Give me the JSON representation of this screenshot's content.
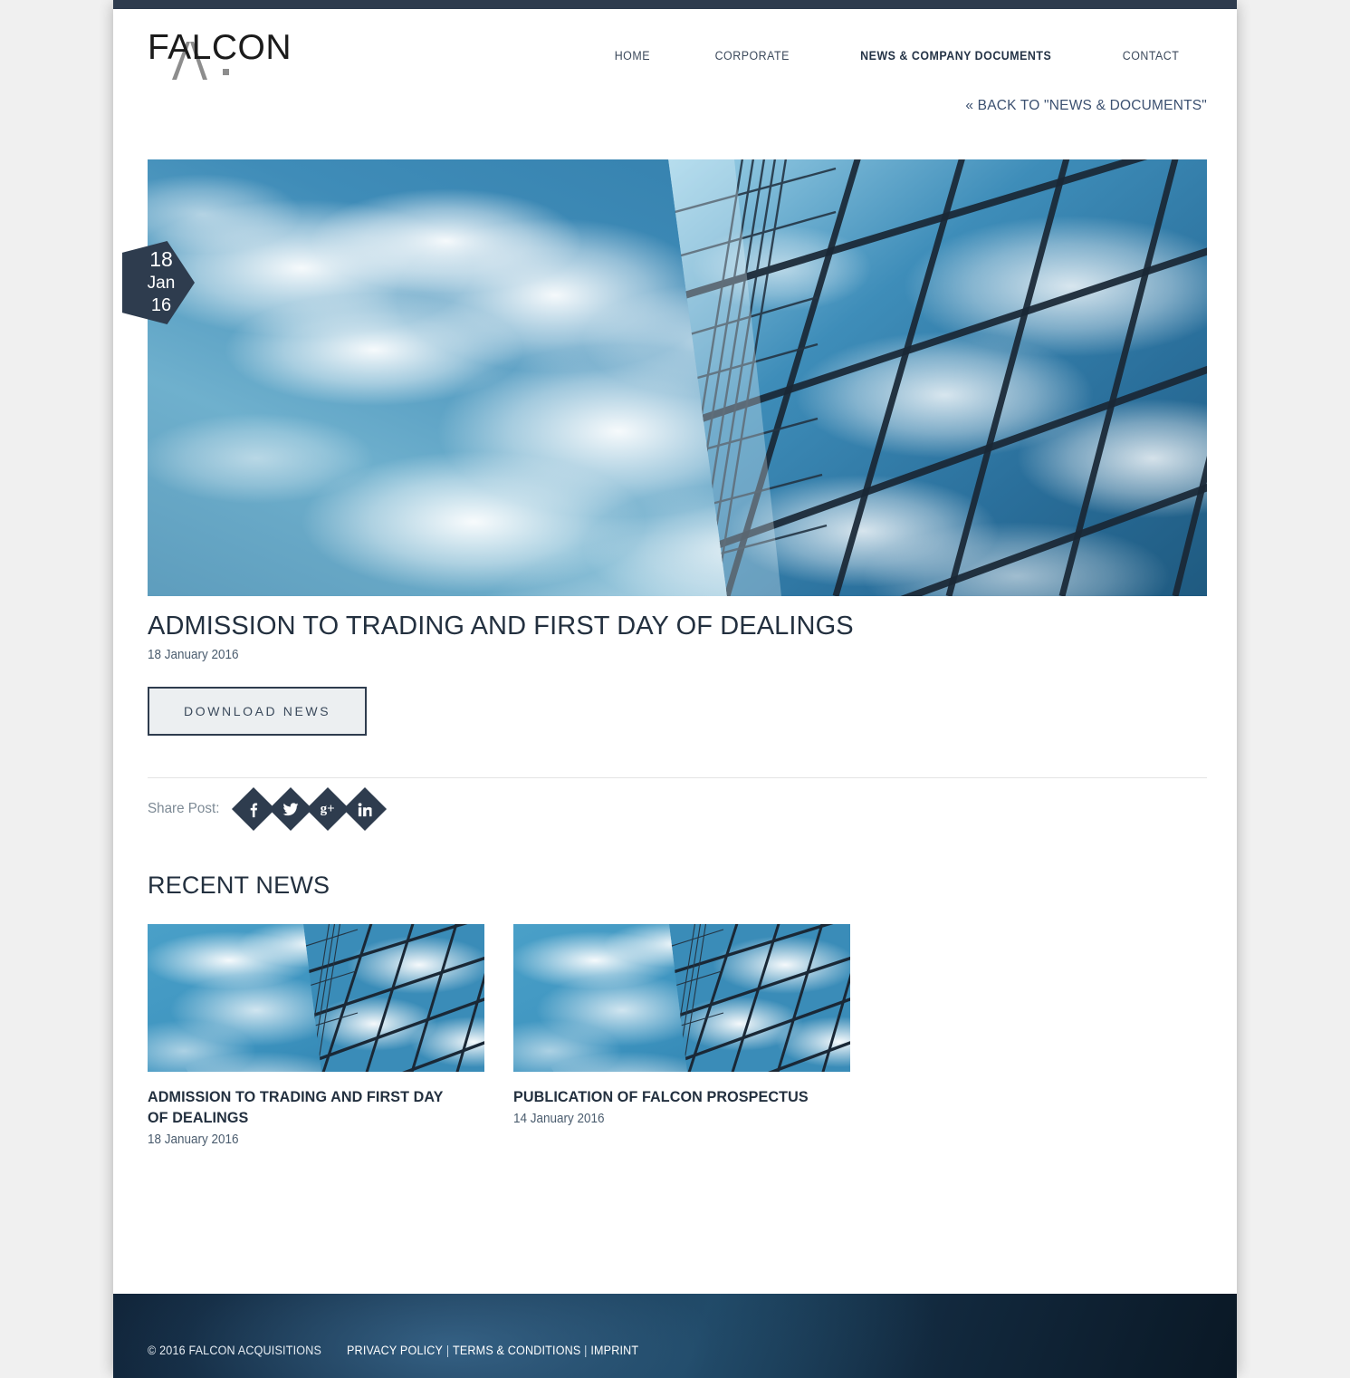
{
  "brand": {
    "logo_text": "FALCON"
  },
  "nav": {
    "items": [
      {
        "label": "HOME",
        "active": false
      },
      {
        "label": "CORPORATE",
        "active": false
      },
      {
        "label": "NEWS & COMPANY DOCUMENTS",
        "active": true
      },
      {
        "label": "CONTACT",
        "active": false
      }
    ]
  },
  "back_link": {
    "label": "« BACK TO \"NEWS & DOCUMENTS\""
  },
  "hero": {
    "image_alt": "glass-skyscraper-facade-reflecting-blue-sky-and-clouds",
    "date_badge": {
      "day": "18",
      "month": "Jan",
      "year": "16"
    }
  },
  "article": {
    "title": "ADMISSION TO TRADING AND FIRST DAY OF DEALINGS",
    "date": "18 January 2016",
    "download_label": "DOWNLOAD NEWS"
  },
  "share": {
    "label": "Share Post:",
    "buttons": [
      {
        "name": "facebook",
        "glyph": "f"
      },
      {
        "name": "twitter",
        "glyph": "t"
      },
      {
        "name": "googleplus",
        "glyph": "g+"
      },
      {
        "name": "linkedin",
        "glyph": "in"
      }
    ]
  },
  "recent_news": {
    "heading": "RECENT NEWS",
    "items": [
      {
        "title": "ADMISSION TO TRADING AND FIRST DAY OF DEALINGS",
        "date": "18 January 2016",
        "image_alt": "glass-skyscraper-facade-reflecting-blue-sky-and-clouds"
      },
      {
        "title": "PUBLICATION OF FALCON PROSPECTUS",
        "date": "14 January 2016",
        "image_alt": "glass-skyscraper-facade-reflecting-blue-sky-and-clouds"
      }
    ]
  },
  "footer": {
    "copyright": "© 2016 FALCON ACQUISITIONS",
    "links": [
      {
        "label": "PRIVACY POLICY"
      },
      {
        "label": "TERMS & CONDITIONS"
      },
      {
        "label": "IMPRINT"
      }
    ],
    "separator": "|"
  },
  "colors": {
    "navy": "#2e3c4e",
    "page_bg": "#f0f0f0",
    "button_bg": "#eceff1",
    "link": "#3b5070"
  }
}
